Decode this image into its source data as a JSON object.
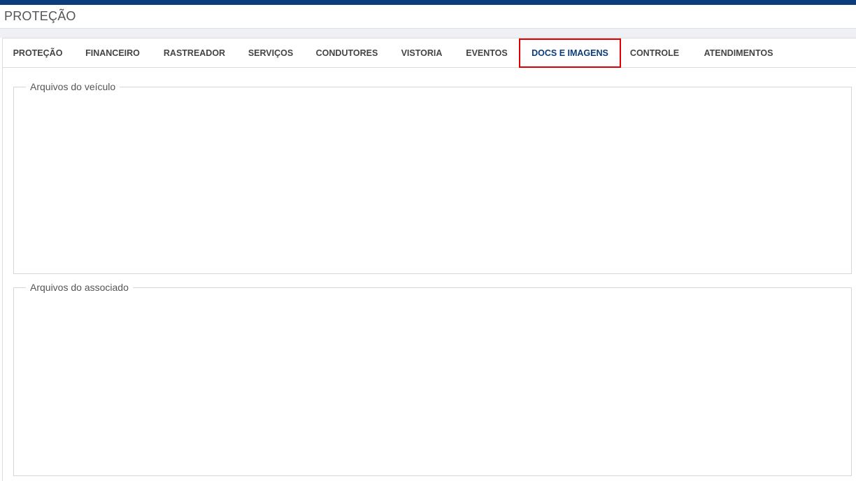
{
  "header": {
    "title": "PROTEÇÃO"
  },
  "tabs": [
    {
      "label": "PROTEÇÃO",
      "active": false
    },
    {
      "label": "FINANCEIRO",
      "active": false
    },
    {
      "label": "RASTREADOR",
      "active": false
    },
    {
      "label": "SERVIÇOS",
      "active": false
    },
    {
      "label": "CONDUTORES",
      "active": false
    },
    {
      "label": "VISTORIA",
      "active": false
    },
    {
      "label": "EVENTOS",
      "active": false
    },
    {
      "label": "DOCS E IMAGENS",
      "active": true
    },
    {
      "label": "CONTROLE",
      "active": false
    },
    {
      "label": "ATENDIMENTOS",
      "active": false
    }
  ],
  "sections": {
    "vehicle_files": {
      "legend": "Arquivos do veículo"
    },
    "member_files": {
      "legend": "Arquivos do associado"
    }
  },
  "colors": {
    "accent": "#0b3d7a",
    "highlight": "#e00000",
    "tab_text": "#444444"
  }
}
